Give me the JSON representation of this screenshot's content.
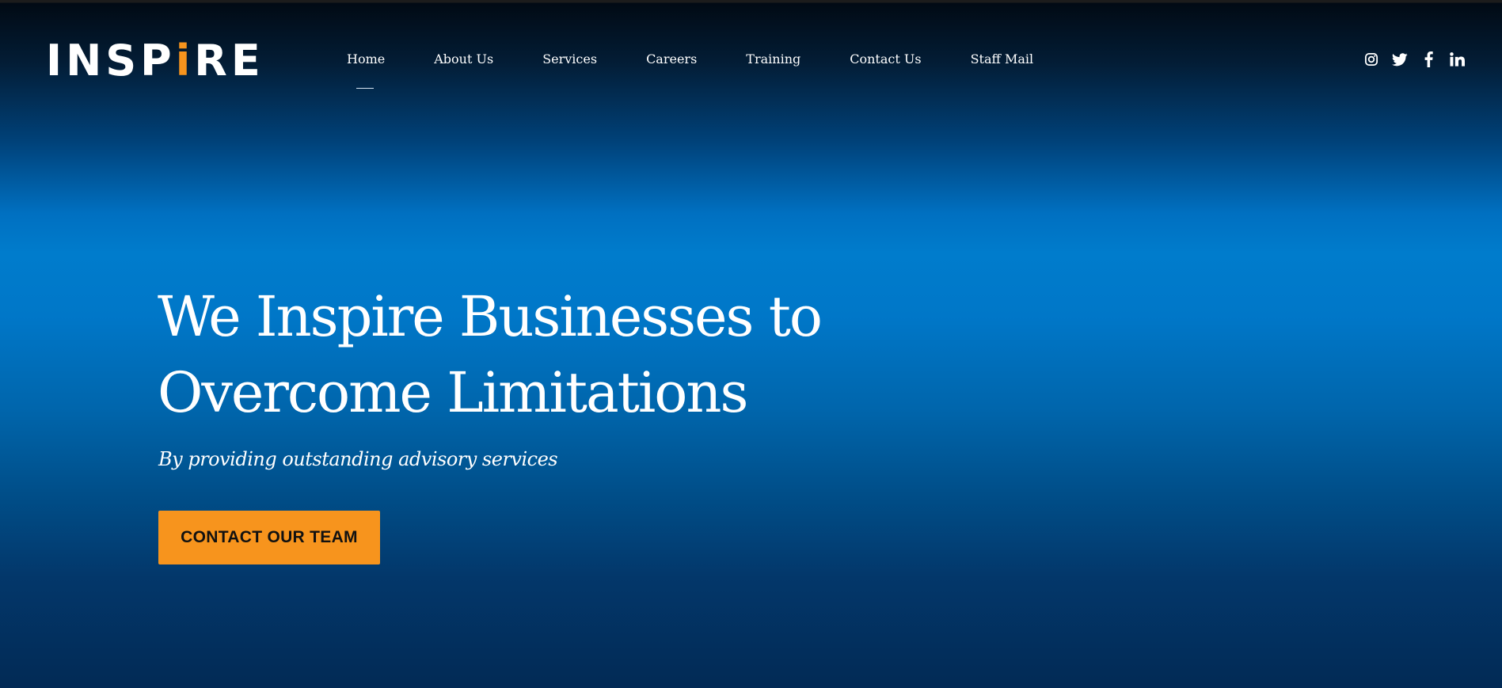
{
  "brand": {
    "logo_part1": "INSP",
    "logo_accent": "i",
    "logo_part2": "RE",
    "accent_color": "#f7941d"
  },
  "nav": {
    "items": [
      {
        "label": "Home",
        "active": true
      },
      {
        "label": "About Us"
      },
      {
        "label": "Services"
      },
      {
        "label": "Careers"
      },
      {
        "label": "Training"
      },
      {
        "label": "Contact Us"
      },
      {
        "label": "Staff Mail"
      }
    ]
  },
  "social": {
    "icons": [
      "instagram-icon",
      "twitter-icon",
      "facebook-icon",
      "linkedin-icon"
    ]
  },
  "hero": {
    "headline_line1": "We Inspire Businesses to",
    "headline_line2": "Overcome Limitations",
    "subheadline": "By providing outstanding advisory services",
    "cta_label": "CONTACT OUR TEAM",
    "background_color": "#0077c8",
    "cta_color": "#f7941d"
  }
}
